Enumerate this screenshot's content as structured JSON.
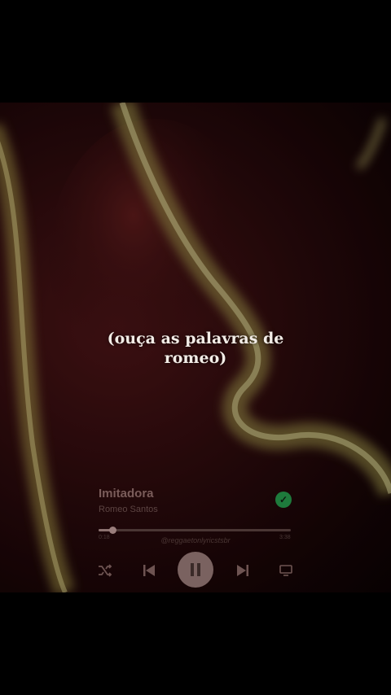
{
  "lyric": {
    "line1": "(ouça as palavras de",
    "line2": "romeo)"
  },
  "player": {
    "song_title": "Imitadora",
    "artist": "Romeo Santos",
    "elapsed": "0:18",
    "duration": "3:38",
    "progress_fraction": 0.075,
    "liked": true,
    "watermark": "@reggaetonlyricstsbr"
  },
  "icons": {
    "liked": "check-circle-icon",
    "shuffle": "shuffle-icon",
    "previous": "skip-previous-icon",
    "pause": "pause-icon",
    "next": "skip-next-icon",
    "devices": "connect-device-icon"
  },
  "colors": {
    "accent_green": "#1e7a3c",
    "background": "#000000",
    "lyric_text": "#f2ece6"
  }
}
